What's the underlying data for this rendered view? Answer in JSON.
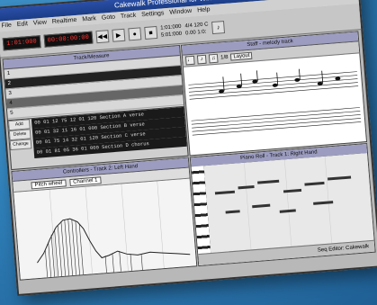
{
  "window": {
    "title": "Cakewalk Professional for Windows 4.0"
  },
  "menu": [
    "File",
    "Edit",
    "View",
    "Realtime",
    "Mark",
    "Goto",
    "Track",
    "Settings",
    "Window",
    "Help"
  ],
  "toolbar": {
    "counter": "1:01:000",
    "time": "00:00:00:00",
    "from": "1:01:000",
    "thru": "5:01:000",
    "meter": "4/4 120 C",
    "tempo": "0.00 1:0:"
  },
  "track_pane": {
    "title": "Track/Measure"
  },
  "events": {
    "buttons": [
      "Add",
      "Delete",
      "Change"
    ],
    "rows": [
      "00 01 12 75  12 01 120 Section A verse",
      "00 01 32 11  16 01 000 Section B verse",
      "00 01 75 14  32 01 120 Section C verse",
      "00 01 81 05  36 01 000 Section D chorus"
    ]
  },
  "staff_pane": {
    "title": "Staff - melody track",
    "zoom": "1/8",
    "mode": "Layout"
  },
  "controllers_pane": {
    "title": "Controllers - Track 2: Left Hand",
    "dropdown": "Pitch wheel",
    "channel": "Channel 1"
  },
  "piano_pane": {
    "title": "Piano Roll - Track 1: Right Hand"
  },
  "status": {
    "text": "Seq Editor: Cakewalk"
  },
  "colors": {
    "lcd_text": "#ff3333",
    "pane_title": "#9c9cc0"
  }
}
